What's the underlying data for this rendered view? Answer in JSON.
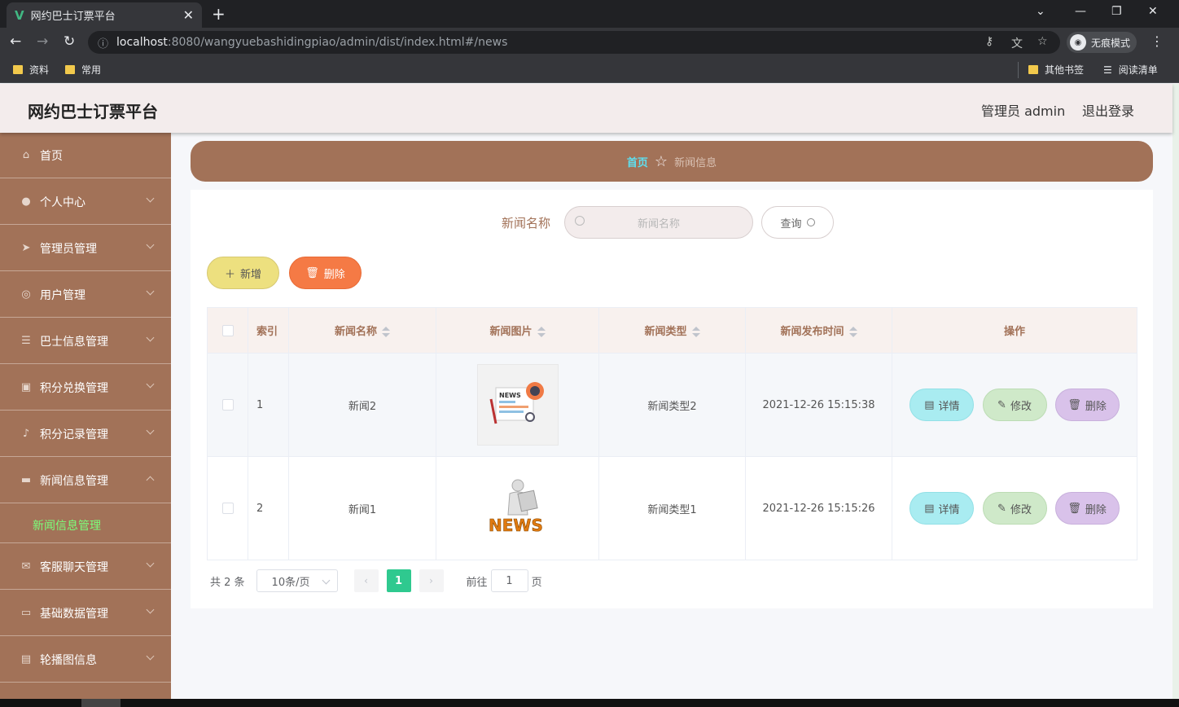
{
  "browser": {
    "tab_title": "网约巴士订票平台",
    "tab_logo": "V",
    "url_host": "localhost",
    "url_path": ":8080/wangyuebashidingpiao/admin/dist/index.html#/news",
    "incognito_label": "无痕模式",
    "bookmarks": [
      "资料",
      "常用"
    ],
    "bookmarks_right": [
      "其他书签",
      "阅读清单"
    ]
  },
  "header": {
    "title": "网约巴士订票平台",
    "user": "管理员 admin",
    "logout": "退出登录"
  },
  "sidebar": {
    "items": [
      {
        "label": "首页",
        "icon": "home-icon"
      },
      {
        "label": "个人中心",
        "icon": "user-icon"
      },
      {
        "label": "管理员管理",
        "icon": "send-icon"
      },
      {
        "label": "用户管理",
        "icon": "lifebuoy-icon"
      },
      {
        "label": "巴士信息管理",
        "icon": "sliders-icon"
      },
      {
        "label": "积分兑换管理",
        "icon": "clipboard-icon"
      },
      {
        "label": "积分记录管理",
        "icon": "microphone-icon"
      },
      {
        "label": "新闻信息管理",
        "icon": "monitor-icon"
      },
      {
        "label": "客服聊天管理",
        "icon": "mail-icon"
      },
      {
        "label": "基础数据管理",
        "icon": "chat-icon"
      },
      {
        "label": "轮播图信息",
        "icon": "briefcase-icon"
      }
    ],
    "active_sub": "新闻信息管理"
  },
  "breadcrumb": {
    "home": "首页",
    "current": "新闻信息"
  },
  "search": {
    "label": "新闻名称",
    "placeholder": "新闻名称",
    "query_button": "查询"
  },
  "actions": {
    "add": "新增",
    "delete": "删除"
  },
  "table": {
    "headers": [
      "索引",
      "新闻名称",
      "新闻图片",
      "新闻类型",
      "新闻发布时间",
      "操作"
    ],
    "rows": [
      {
        "index": "1",
        "name": "新闻2",
        "type": "新闻类型2",
        "time": "2021-12-26 15:15:38"
      },
      {
        "index": "2",
        "name": "新闻1",
        "type": "新闻类型1",
        "time": "2021-12-26 15:15:26"
      }
    ],
    "op_labels": {
      "detail": "详情",
      "edit": "修改",
      "delete": "删除"
    },
    "image_text": "NEWS"
  },
  "pagination": {
    "total": "共 2 条",
    "page_size": "10条/页",
    "current": "1",
    "goto_prefix": "前往",
    "goto_value": "1",
    "goto_suffix": "页"
  }
}
